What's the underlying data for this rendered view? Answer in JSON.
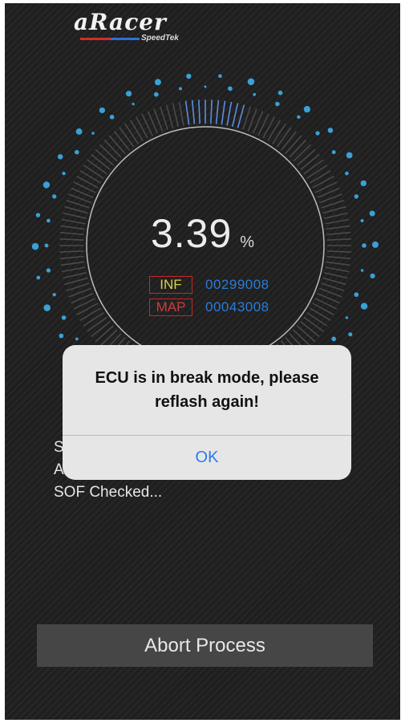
{
  "brand": {
    "logo_text": "aRacer",
    "logo_sub": "SpeedTek"
  },
  "progress": {
    "value": "3.39",
    "unit": "%",
    "fraction": 0.0339
  },
  "info": [
    {
      "tag": "INF",
      "value": "00299008",
      "tag_color": "#d8d24a"
    },
    {
      "tag": "MAP",
      "value": "00043008",
      "tag_color": "#d03b3b"
    }
  ],
  "log": {
    "lines": [
      "S",
      "A",
      "SOF Checked..."
    ]
  },
  "dialog": {
    "message": "ECU is in break mode, please reflash again!",
    "ok_label": "OK"
  },
  "abort_label": "Abort Process",
  "colors": {
    "accent_blue": "#2a7cf0",
    "gauge_dots": "#3aa0d8",
    "tag_border": "#c62828"
  }
}
